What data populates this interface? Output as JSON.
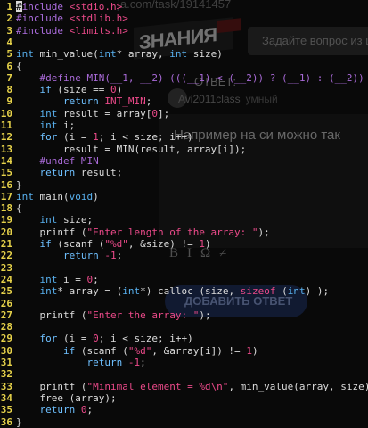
{
  "background_page": {
    "url_text": "ja.com/task/19141457",
    "logo_text": "ЗНАНИЯ",
    "search_placeholder": "Задайте вопрос из ш",
    "answer_label": "ОТВЕТ:",
    "username": "Avi2011class",
    "user_rank": "умный",
    "answer_text": "Например на си можно так",
    "format_buttons": [
      "B",
      "Ι",
      "Ω",
      "≠"
    ],
    "add_answer_button": "ДОБАВИТЬ ОТВЕТ"
  },
  "editor": {
    "colors": {
      "line_number": "#e6d24a",
      "keyword": "#6ec0ff",
      "preprocessor": "#ad6ee0",
      "string": "#ec4a8a",
      "text": "#dcdcdc"
    },
    "cursor_char": "#",
    "lines": [
      {
        "n": "1",
        "parts": [
          {
            "t": "include ",
            "c": "pp"
          },
          {
            "t": "<stdio.h>",
            "c": "str"
          }
        ]
      },
      {
        "n": "2",
        "parts": [
          {
            "t": "#include ",
            "c": "pp"
          },
          {
            "t": "<stdlib.h>",
            "c": "str"
          }
        ]
      },
      {
        "n": "3",
        "parts": [
          {
            "t": "#include ",
            "c": "pp"
          },
          {
            "t": "<limits.h>",
            "c": "str"
          }
        ]
      },
      {
        "n": "4",
        "parts": []
      },
      {
        "n": "5",
        "parts": [
          {
            "t": "int",
            "c": "ty"
          },
          {
            "t": " min_value(",
            "c": ""
          },
          {
            "t": "int",
            "c": "ty"
          },
          {
            "t": "* array, ",
            "c": ""
          },
          {
            "t": "int",
            "c": "ty"
          },
          {
            "t": " size)",
            "c": ""
          }
        ]
      },
      {
        "n": "6",
        "parts": [
          {
            "t": "{",
            "c": ""
          }
        ]
      },
      {
        "n": "7",
        "parts": [
          {
            "t": "    #define MIN(__1, __2) (((__1) < (__2)) ? (__1) : (__2))",
            "c": "co"
          }
        ]
      },
      {
        "n": "8",
        "parts": [
          {
            "t": "    ",
            "c": ""
          },
          {
            "t": "if",
            "c": "kw"
          },
          {
            "t": " (size == ",
            "c": ""
          },
          {
            "t": "0",
            "c": "num"
          },
          {
            "t": ")",
            "c": ""
          }
        ]
      },
      {
        "n": "9",
        "parts": [
          {
            "t": "        ",
            "c": ""
          },
          {
            "t": "return",
            "c": "kw"
          },
          {
            "t": " ",
            "c": ""
          },
          {
            "t": "INT_MIN",
            "c": "str"
          },
          {
            "t": ";",
            "c": ""
          }
        ]
      },
      {
        "n": "10",
        "parts": [
          {
            "t": "    ",
            "c": ""
          },
          {
            "t": "int",
            "c": "ty"
          },
          {
            "t": " result = array[",
            "c": ""
          },
          {
            "t": "0",
            "c": "num"
          },
          {
            "t": "];",
            "c": ""
          }
        ]
      },
      {
        "n": "11",
        "parts": [
          {
            "t": "    ",
            "c": ""
          },
          {
            "t": "int",
            "c": "ty"
          },
          {
            "t": " i;",
            "c": ""
          }
        ]
      },
      {
        "n": "12",
        "parts": [
          {
            "t": "    ",
            "c": ""
          },
          {
            "t": "for",
            "c": "kw"
          },
          {
            "t": " (i = ",
            "c": ""
          },
          {
            "t": "1",
            "c": "num"
          },
          {
            "t": "; i < size; i++)",
            "c": ""
          }
        ]
      },
      {
        "n": "13",
        "parts": [
          {
            "t": "        result = MIN(result, array[i]);",
            "c": ""
          }
        ]
      },
      {
        "n": "14",
        "parts": [
          {
            "t": "    #undef MIN",
            "c": "co"
          }
        ]
      },
      {
        "n": "15",
        "parts": [
          {
            "t": "    ",
            "c": ""
          },
          {
            "t": "return",
            "c": "kw"
          },
          {
            "t": " result;",
            "c": ""
          }
        ]
      },
      {
        "n": "16",
        "parts": [
          {
            "t": "}",
            "c": ""
          }
        ]
      },
      {
        "n": "17",
        "parts": [
          {
            "t": "int",
            "c": "ty"
          },
          {
            "t": " main(",
            "c": ""
          },
          {
            "t": "void",
            "c": "ty"
          },
          {
            "t": ")",
            "c": ""
          }
        ]
      },
      {
        "n": "18",
        "parts": [
          {
            "t": "{",
            "c": ""
          }
        ]
      },
      {
        "n": "19",
        "parts": [
          {
            "t": "    ",
            "c": ""
          },
          {
            "t": "int",
            "c": "ty"
          },
          {
            "t": " size;",
            "c": ""
          }
        ]
      },
      {
        "n": "20",
        "parts": [
          {
            "t": "    printf (",
            "c": ""
          },
          {
            "t": "\"Enter length of the array: \"",
            "c": "str"
          },
          {
            "t": ");",
            "c": ""
          }
        ]
      },
      {
        "n": "21",
        "parts": [
          {
            "t": "    ",
            "c": ""
          },
          {
            "t": "if",
            "c": "kw"
          },
          {
            "t": " (scanf (",
            "c": ""
          },
          {
            "t": "\"%d\"",
            "c": "str"
          },
          {
            "t": ", &size) != ",
            "c": ""
          },
          {
            "t": "1",
            "c": "num"
          },
          {
            "t": ")",
            "c": ""
          }
        ]
      },
      {
        "n": "22",
        "parts": [
          {
            "t": "        ",
            "c": ""
          },
          {
            "t": "return",
            "c": "kw"
          },
          {
            "t": " ",
            "c": ""
          },
          {
            "t": "-1",
            "c": "num"
          },
          {
            "t": ";",
            "c": ""
          }
        ]
      },
      {
        "n": "23",
        "parts": []
      },
      {
        "n": "24",
        "parts": [
          {
            "t": "    ",
            "c": ""
          },
          {
            "t": "int",
            "c": "ty"
          },
          {
            "t": " i = ",
            "c": ""
          },
          {
            "t": "0",
            "c": "num"
          },
          {
            "t": ";",
            "c": ""
          }
        ]
      },
      {
        "n": "25",
        "parts": [
          {
            "t": "    ",
            "c": ""
          },
          {
            "t": "int",
            "c": "ty"
          },
          {
            "t": "* array = (",
            "c": ""
          },
          {
            "t": "int",
            "c": "ty"
          },
          {
            "t": "*) calloc (size, ",
            "c": ""
          },
          {
            "t": "sizeof",
            "c": "str"
          },
          {
            "t": " (",
            "c": ""
          },
          {
            "t": "int",
            "c": "ty"
          },
          {
            "t": ") );",
            "c": ""
          }
        ]
      },
      {
        "n": "26",
        "parts": []
      },
      {
        "n": "27",
        "parts": [
          {
            "t": "    printf (",
            "c": ""
          },
          {
            "t": "\"Enter the array: \"",
            "c": "str"
          },
          {
            "t": ");",
            "c": ""
          }
        ]
      },
      {
        "n": "28",
        "parts": []
      },
      {
        "n": "29",
        "parts": [
          {
            "t": "    ",
            "c": ""
          },
          {
            "t": "for",
            "c": "kw"
          },
          {
            "t": " (i = ",
            "c": ""
          },
          {
            "t": "0",
            "c": "num"
          },
          {
            "t": "; i < size; i++)",
            "c": ""
          }
        ]
      },
      {
        "n": "30",
        "parts": [
          {
            "t": "        ",
            "c": ""
          },
          {
            "t": "if",
            "c": "kw"
          },
          {
            "t": " (scanf (",
            "c": ""
          },
          {
            "t": "\"%d\"",
            "c": "str"
          },
          {
            "t": ", &array[i]) != ",
            "c": ""
          },
          {
            "t": "1",
            "c": "num"
          },
          {
            "t": ")",
            "c": ""
          }
        ]
      },
      {
        "n": "31",
        "parts": [
          {
            "t": "            ",
            "c": ""
          },
          {
            "t": "return",
            "c": "kw"
          },
          {
            "t": " ",
            "c": ""
          },
          {
            "t": "-1",
            "c": "num"
          },
          {
            "t": ";",
            "c": ""
          }
        ]
      },
      {
        "n": "32",
        "parts": []
      },
      {
        "n": "33",
        "parts": [
          {
            "t": "    printf (",
            "c": ""
          },
          {
            "t": "\"Minimal element = %d\\n\"",
            "c": "str"
          },
          {
            "t": ", min_value(array, size));",
            "c": ""
          }
        ]
      },
      {
        "n": "34",
        "parts": [
          {
            "t": "    free (array);",
            "c": ""
          }
        ]
      },
      {
        "n": "35",
        "parts": [
          {
            "t": "    ",
            "c": ""
          },
          {
            "t": "return",
            "c": "kw"
          },
          {
            "t": " ",
            "c": ""
          },
          {
            "t": "0",
            "c": "num"
          },
          {
            "t": ";",
            "c": ""
          }
        ]
      },
      {
        "n": "36",
        "parts": [
          {
            "t": "}",
            "c": ""
          }
        ]
      }
    ]
  }
}
